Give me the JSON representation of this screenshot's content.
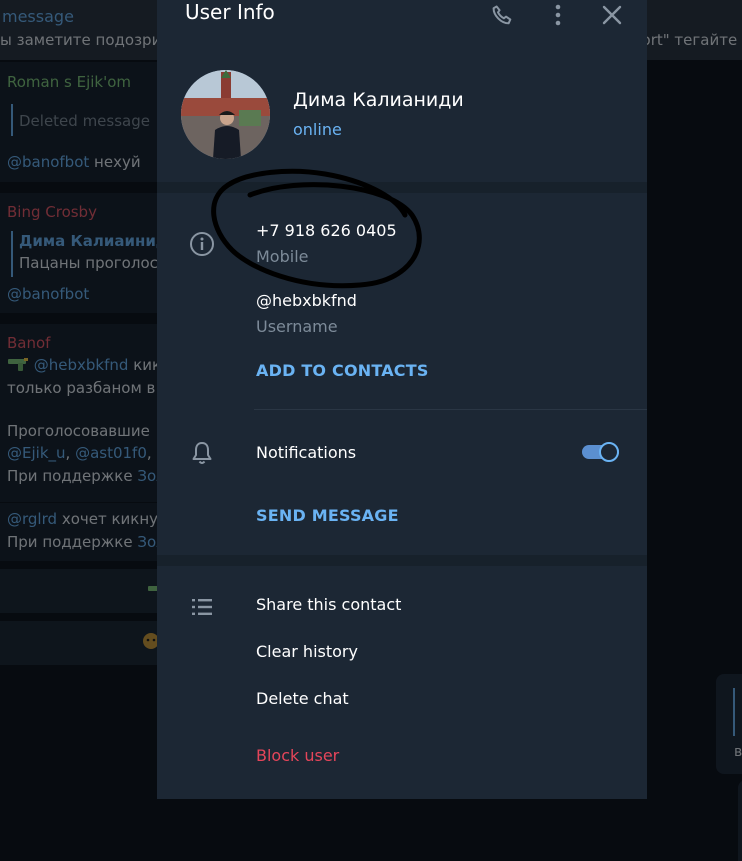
{
  "background_chat": {
    "header_title": "message",
    "header_preview_left": "ы заметите подозрит",
    "header_preview_right": "port\" тегайте",
    "messages": [
      {
        "author": "Roman s Ejik'om",
        "quote": "Deleted message",
        "mention": "@banofbot",
        "text": "нехуй"
      },
      {
        "author": "Bing Crosby",
        "quote_author": "Дима Калиаиниди",
        "quote_text": "Пацаны проголос",
        "mention": "@banofbot"
      },
      {
        "author": "Banof",
        "mention": "@hebxbkfnd",
        "text1": "кик",
        "line2": "только разбаном в",
        "line3": "Проголосовавшие",
        "line4_mentions": [
          "@Ejik_u",
          "@ast01f0",
          "@"
        ],
        "line5_prefix": "При поддержке",
        "line5_link": "Зол"
      },
      {
        "mention": "@rglrd",
        "text": "хочет кикнут",
        "line2_prefix": "При поддержке",
        "line2_link": "Зол"
      }
    ],
    "right_card_text": "в"
  },
  "user_info": {
    "title": "User Info",
    "name": "Дима Калианиди",
    "status": "online",
    "phone": "+7 918 626 0405",
    "phone_label": "Mobile",
    "username": "@hebxbkfnd",
    "username_label": "Username",
    "add_to_contacts": "ADD TO CONTACTS",
    "notifications_label": "Notifications",
    "notifications_enabled": true,
    "send_message": "SEND MESSAGE",
    "actions": {
      "share": "Share this contact",
      "clear": "Clear history",
      "delete": "Delete chat",
      "block": "Block user"
    }
  },
  "icons": [
    "phone-icon",
    "more-vertical-icon",
    "close-icon",
    "info-icon",
    "bell-icon",
    "list-icon"
  ],
  "colors": {
    "accent": "#6ab3f3",
    "danger": "#e5455a",
    "panel": "#1c2734",
    "background": "#0e1621"
  }
}
